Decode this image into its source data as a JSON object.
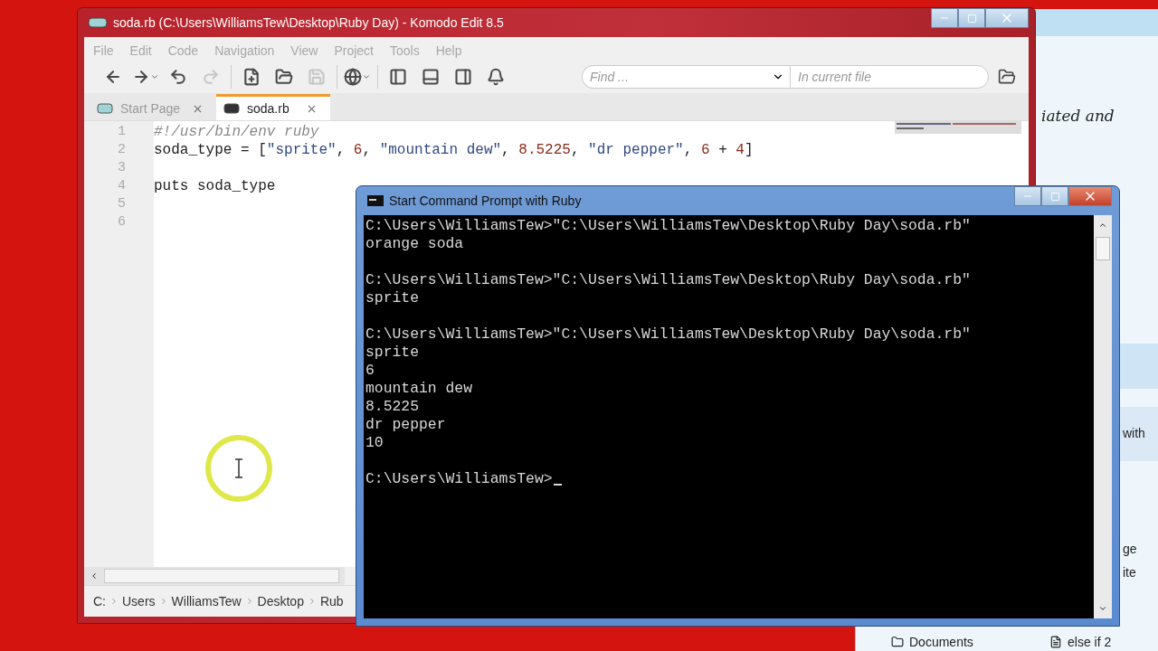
{
  "background_window": {
    "texts": [
      "iated and",
      "with",
      "ge",
      "ite"
    ],
    "taskbar": [
      {
        "label": "Documents"
      },
      {
        "label": "else if 2"
      }
    ]
  },
  "editor_window": {
    "title": "soda.rb (C:\\Users\\WilliamsTew\\Desktop\\Ruby Day) - Komodo Edit 8.5",
    "menu": [
      "File",
      "Edit",
      "Code",
      "Navigation",
      "View",
      "Project",
      "Tools",
      "Help"
    ],
    "toolbar": [
      {
        "disabled": false,
        "dropdown": false
      },
      {
        "disabled": false,
        "dropdown": true
      },
      {
        "disabled": false,
        "dropdown": false
      },
      {
        "disabled": true,
        "dropdown": false
      },
      {
        "disabled": false,
        "dropdown": false
      },
      {
        "disabled": false,
        "dropdown": false
      },
      {
        "disabled": true,
        "dropdown": false
      },
      {
        "disabled": false,
        "dropdown": true
      },
      {
        "disabled": false,
        "dropdown": false
      },
      {
        "disabled": false,
        "dropdown": false
      },
      {
        "disabled": false,
        "dropdown": false
      },
      {
        "disabled": false,
        "dropdown": false
      }
    ],
    "find": {
      "placeholder": "Find ..."
    },
    "scope": {
      "placeholder": "In current file"
    },
    "tabs": [
      {
        "label": "Start Page",
        "selected": false
      },
      {
        "label": "soda.rb",
        "selected": true
      }
    ],
    "lines": [
      {
        "number": "1",
        "tokens": [
          {
            "kind": "comment",
            "text": "#!/usr/bin/env ruby"
          }
        ]
      },
      {
        "number": "2",
        "tokens": [
          {
            "kind": "plain",
            "text": "soda_type = ["
          },
          {
            "kind": "string",
            "text": "\"sprite\""
          },
          {
            "kind": "plain",
            "text": ", "
          },
          {
            "kind": "number",
            "text": "6"
          },
          {
            "kind": "plain",
            "text": ", "
          },
          {
            "kind": "string",
            "text": "\"mountain dew\""
          },
          {
            "kind": "plain",
            "text": ", "
          },
          {
            "kind": "number",
            "text": "8.5225"
          },
          {
            "kind": "plain",
            "text": ", "
          },
          {
            "kind": "string",
            "text": "\"dr pepper\""
          },
          {
            "kind": "plain",
            "text": ", "
          },
          {
            "kind": "number",
            "text": "6"
          },
          {
            "kind": "plain",
            "text": " + "
          },
          {
            "kind": "number",
            "text": "4"
          },
          {
            "kind": "plain",
            "text": "]"
          }
        ]
      },
      {
        "number": "3"
      },
      {
        "number": "4",
        "tokens": [
          {
            "kind": "plain",
            "text": "puts soda_type"
          }
        ]
      },
      {
        "number": "5"
      },
      {
        "number": "6"
      }
    ],
    "breadcrumb": [
      "C:",
      "Users",
      "WilliamsTew",
      "Desktop",
      "Rub"
    ]
  },
  "console_window": {
    "title": "Start Command Prompt with Ruby",
    "blocks": [
      {
        "lines": [
          "C:\\Users\\WilliamsTew>\"C:\\Users\\WilliamsTew\\Desktop\\Ruby Day\\soda.rb\"",
          "orange soda"
        ]
      },
      {
        "lines": [
          "C:\\Users\\WilliamsTew>\"C:\\Users\\WilliamsTew\\Desktop\\Ruby Day\\soda.rb\"",
          "sprite"
        ]
      },
      {
        "lines": [
          "C:\\Users\\WilliamsTew>\"C:\\Users\\WilliamsTew\\Desktop\\Ruby Day\\soda.rb\"",
          "sprite",
          "6",
          "mountain dew",
          "8.5225",
          "dr pepper",
          "10"
        ]
      },
      {
        "lines": [
          "C:\\Users\\WilliamsTew>"
        ],
        "cursor": true
      }
    ]
  }
}
